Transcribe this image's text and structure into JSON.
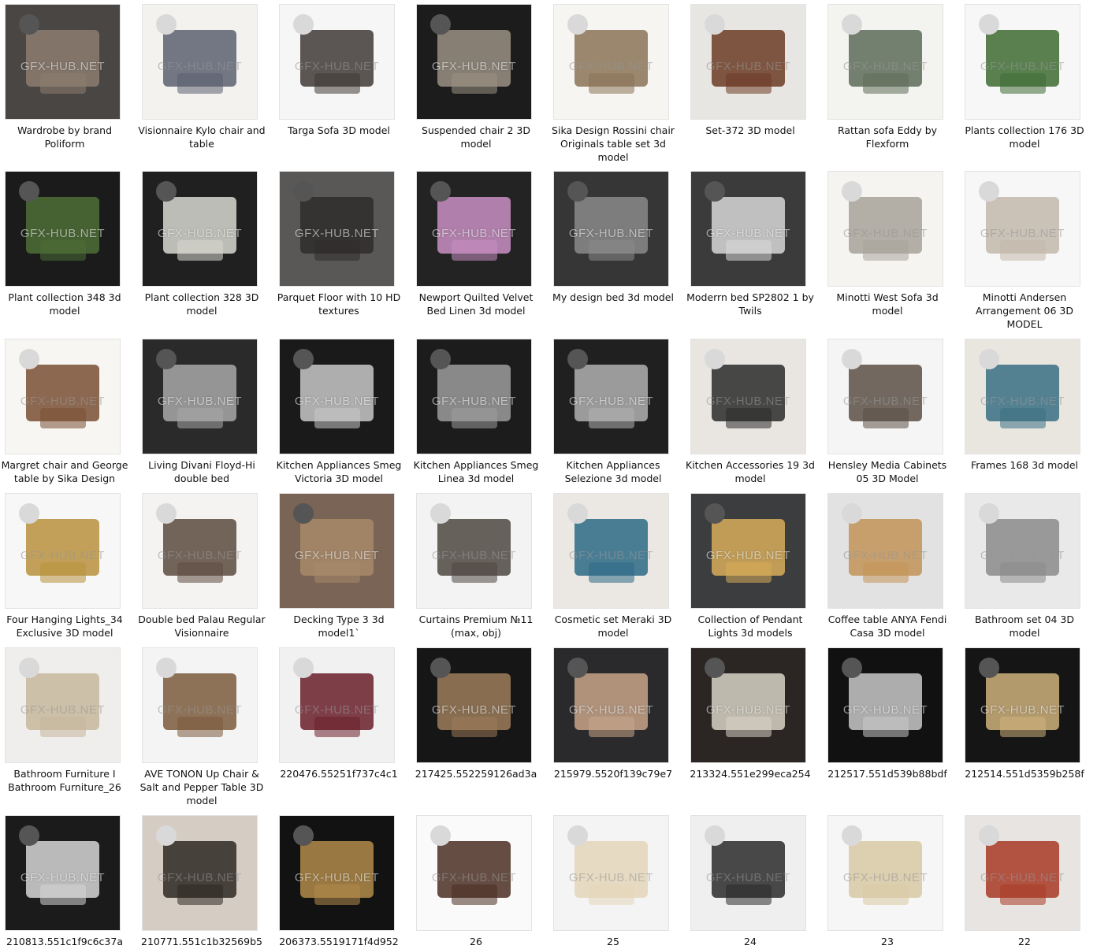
{
  "watermark": "GFX-HUB.NET",
  "items": [
    {
      "label": "Wardrobe by brand Poliform",
      "icon": "wardrobe-icon",
      "bg": "#4a4644",
      "accent": "#8c7d70",
      "light": false
    },
    {
      "label": "Visionnaire Kylo chair and table",
      "icon": "chairs-icon",
      "bg": "#f4f2ef",
      "accent": "#5b6170",
      "light": true
    },
    {
      "label": "Targa Sofa 3D model",
      "icon": "sofa-icon",
      "bg": "#f6f6f6",
      "accent": "#3f3a36",
      "light": true
    },
    {
      "label": "Suspended chair 2 3D model",
      "icon": "hanging-chair-icon",
      "bg": "#1c1c1c",
      "accent": "#9a9184",
      "light": false
    },
    {
      "label": "Sika Design Rossini chair Originals table set 3d model",
      "icon": "chairs-icon",
      "bg": "#f7f5f2",
      "accent": "#8a7357",
      "light": true
    },
    {
      "label": "Set-372 3D model",
      "icon": "bottles-icon",
      "bg": "#e8e6e3",
      "accent": "#6b3b25",
      "light": true
    },
    {
      "label": "Rattan sofa Eddy by Flexform",
      "icon": "sofa-icon",
      "bg": "#f3f3f0",
      "accent": "#5d6b58",
      "light": true
    },
    {
      "label": "Plants collection 176 3D model",
      "icon": "plant-icon",
      "bg": "#f7f7f7",
      "accent": "#3e6b33",
      "light": true
    },
    {
      "label": "Plant collection 348 3d model",
      "icon": "plant-icon",
      "bg": "#1b1b1b",
      "accent": "#4d6e36",
      "light": false
    },
    {
      "label": "Plant collection 328 3D model",
      "icon": "plant-icon",
      "bg": "#202020",
      "accent": "#d9d9d2",
      "light": false
    },
    {
      "label": "Parquet Floor with 10 HD textures",
      "icon": "floor-icon",
      "bg": "#5a5857",
      "accent": "#2f2c2b",
      "light": false
    },
    {
      "label": "Newport Quilted Velvet Bed Linen 3d model",
      "icon": "bed-icon",
      "bg": "#232323",
      "accent": "#c98fc3",
      "light": false
    },
    {
      "label": "My design bed 3d model",
      "icon": "bed-icon",
      "bg": "#363636",
      "accent": "#8a8a8a",
      "light": false
    },
    {
      "label": "Moderrn bed SP2802 1 by Twils",
      "icon": "bed-icon",
      "bg": "#3b3b3b",
      "accent": "#d8d8d8",
      "light": false
    },
    {
      "label": "Minotti West Sofa 3d model",
      "icon": "sofa-icon",
      "bg": "#f5f4f1",
      "accent": "#a7a29a",
      "light": true
    },
    {
      "label": "Minotti Andersen Arrangement 06 3D MODEL",
      "icon": "sofa-icon",
      "bg": "#f7f7f7",
      "accent": "#c2b8ab",
      "light": true
    },
    {
      "label": "Margret chair and George table by Sika Design",
      "icon": "chairs-icon",
      "bg": "#f7f6f3",
      "accent": "#7a4f33",
      "light": true
    },
    {
      "label": "Living Divani Floyd-Hi double bed",
      "icon": "bed-icon",
      "bg": "#2a2a2a",
      "accent": "#a8a8a8",
      "light": false
    },
    {
      "label": "Kitchen Appliances Smeg Victoria 3D model",
      "icon": "appliance-icon",
      "bg": "#1a1a1a",
      "accent": "#c9c9c9",
      "light": false
    },
    {
      "label": "Kitchen Appliances Smeg Linea 3d model",
      "icon": "oven-icon",
      "bg": "#1c1c1c",
      "accent": "#9c9c9c",
      "light": false
    },
    {
      "label": "Kitchen Appliances Selezione 3d model",
      "icon": "oven-icon",
      "bg": "#202020",
      "accent": "#b1b1b1",
      "light": false
    },
    {
      "label": "Kitchen Accessories 19 3d model",
      "icon": "pots-icon",
      "bg": "#e9e6e2",
      "accent": "#2a2a2a",
      "light": true
    },
    {
      "label": "Hensley Media Cabinets 05 3D Model",
      "icon": "cabinet-icon",
      "bg": "#f5f5f5",
      "accent": "#5b4f45",
      "light": true
    },
    {
      "label": "Frames 168 3d model",
      "icon": "frame-icon",
      "bg": "#e9e6df",
      "accent": "#3a6f84",
      "light": true
    },
    {
      "label": "Four Hanging Lights_34 Exclusive 3D model",
      "icon": "pendant-lights-icon",
      "bg": "#f7f7f7",
      "accent": "#b8913d",
      "light": true
    },
    {
      "label": "Double bed Palau Regular Visionnaire",
      "icon": "bed-icon",
      "bg": "#f4f3f1",
      "accent": "#5c4a3f",
      "light": true
    },
    {
      "label": "Decking Type 3 3d model1`",
      "icon": "wood-texture-icon",
      "bg": "#7a6455",
      "accent": "#a8896a",
      "light": false
    },
    {
      "label": "Curtains Premium №11 (max, obj)",
      "icon": "curtain-icon",
      "bg": "#f3f3f3",
      "accent": "#4d463f",
      "light": true
    },
    {
      "label": "Cosmetic set Meraki 3D model",
      "icon": "bottles-icon",
      "bg": "#ebe8e3",
      "accent": "#2d6a86",
      "light": true
    },
    {
      "label": "Collection of Pendant Lights 3d models",
      "icon": "pendant-lights-icon",
      "bg": "#3b3d3e",
      "accent": "#d8ad5a",
      "light": false
    },
    {
      "label": "Coffee table ANYA Fendi Casa 3D model",
      "icon": "table-icon",
      "bg": "#e2e2e2",
      "accent": "#c29357",
      "light": true
    },
    {
      "label": "Bathroom set 04 3D model",
      "icon": "bath-set-icon",
      "bg": "#e9e9e9",
      "accent": "#8b8b8b",
      "light": true
    },
    {
      "label": "Bathroom Furniture I Bathroom Furniture_26",
      "icon": "mirror-icon",
      "bg": "#efeeec",
      "accent": "#c7b79c",
      "light": true
    },
    {
      "label": "AVE TONON Up Chair & Salt and Pepper Table 3D model",
      "icon": "chairs-icon",
      "bg": "#f4f4f4",
      "accent": "#7b5a3c",
      "light": true
    },
    {
      "label": "220476.55251f737c4c1",
      "icon": "chandelier-icon",
      "bg": "#f1f1f1",
      "accent": "#6a1f2a",
      "light": true
    },
    {
      "label": "217425.552259126ad3a",
      "icon": "wall-lamp-icon",
      "bg": "#161616",
      "accent": "#9c7c5a",
      "light": false
    },
    {
      "label": "215979.5520f139c79e7",
      "icon": "chandelier-icon",
      "bg": "#2a2a2c",
      "accent": "#c8a58a",
      "light": false
    },
    {
      "label": "213324.551e299eca254",
      "icon": "linear-lamp-icon",
      "bg": "#2b2523",
      "accent": "#d8d4c6",
      "light": false
    },
    {
      "label": "212517.551d539b88bdf",
      "icon": "crystal-lamp-icon",
      "bg": "#111111",
      "accent": "#c9c9c9",
      "light": false
    },
    {
      "label": "212514.551d5359b258f",
      "icon": "crystal-lamp-icon",
      "bg": "#151515",
      "accent": "#cfb27c",
      "light": false
    },
    {
      "label": "210813.551c1f9c6c37a",
      "icon": "chandelier-icon",
      "bg": "#1b1b1b",
      "accent": "#d6d6d6",
      "light": false
    },
    {
      "label": "210771.551c1b32569b5",
      "icon": "pendant-lights-icon",
      "bg": "#d5cdc4",
      "accent": "#2d2822",
      "light": true
    },
    {
      "label": "206373.5519171f4d952",
      "icon": "chandelier-icon",
      "bg": "#121212",
      "accent": "#b38b4a",
      "light": false
    },
    {
      "label": "26",
      "icon": "table-icon",
      "bg": "#fafafa",
      "accent": "#4a2e22",
      "light": true
    },
    {
      "label": "25",
      "icon": "bowl-lamp-icon",
      "bg": "#f4f4f4",
      "accent": "#e3d6b9",
      "light": true
    },
    {
      "label": "24",
      "icon": "lantern-icon",
      "bg": "#efefef",
      "accent": "#2a2a2a",
      "light": true
    },
    {
      "label": "23",
      "icon": "column-icon",
      "bg": "#f6f6f6",
      "accent": "#d8c9a4",
      "light": true
    },
    {
      "label": "22",
      "icon": "arch-icon",
      "bg": "#e7e4e1",
      "accent": "#a83a26",
      "light": true
    }
  ]
}
